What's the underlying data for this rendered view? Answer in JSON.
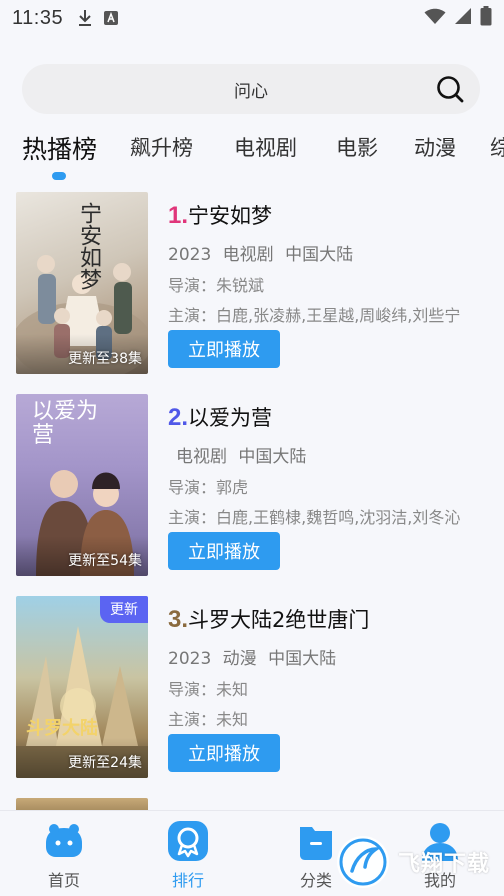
{
  "status_bar": {
    "time": "11:35",
    "icons": [
      "download-icon",
      "text-a-icon",
      "wifi-icon",
      "signal-icon",
      "battery-icon"
    ]
  },
  "search": {
    "query": "问心",
    "icon": "search-icon"
  },
  "tabs": [
    {
      "label": "热播榜",
      "active": true
    },
    {
      "label": "飙升榜",
      "active": false
    },
    {
      "label": "电视剧",
      "active": false
    },
    {
      "label": "电影",
      "active": false
    },
    {
      "label": "动漫",
      "active": false
    },
    {
      "label": "综",
      "active": false
    }
  ],
  "items": [
    {
      "rank": "1.",
      "rank_color": "#e0357a",
      "title": "宁安如梦",
      "year": "2023",
      "genre": "电视剧",
      "region": "中国大陆",
      "director_label": "导演：",
      "director": "朱锐斌",
      "cast_label": "主演：",
      "cast": "白鹿,张凌赫,王星越,周峻纬,刘些宁",
      "update": "更新至38集",
      "badge": "",
      "play_label": "立即播放",
      "poster_text": "宁安如梦"
    },
    {
      "rank": "2.",
      "rank_color": "#5058e8",
      "title": "以爱为营",
      "year": "",
      "genre": "电视剧",
      "region": "中国大陆",
      "director_label": "导演：",
      "director": "郭虎",
      "cast_label": "主演：",
      "cast": "白鹿,王鹤棣,魏哲鸣,沈羽洁,刘冬沁",
      "update": "更新至54集",
      "badge": "",
      "play_label": "立即播放",
      "poster_text": "以爱为营"
    },
    {
      "rank": "3.",
      "rank_color": "#8a6a3e",
      "title": "斗罗大陆2绝世唐门",
      "year": "2023",
      "genre": "动漫",
      "region": "中国大陆",
      "director_label": "导演：",
      "director": "未知",
      "cast_label": "主演：",
      "cast": "未知",
      "update": "更新至24集",
      "badge": "更新",
      "play_label": "立即播放",
      "poster_text": "斗罗大陆"
    }
  ],
  "bottom_nav": [
    {
      "label": "首页",
      "icon": "home-icon",
      "active": false
    },
    {
      "label": "排行",
      "icon": "ranking-icon",
      "active": true
    },
    {
      "label": "分类",
      "icon": "category-icon",
      "active": false
    },
    {
      "label": "我的",
      "icon": "profile-icon",
      "active": false
    }
  ],
  "watermark": {
    "text": "飞翔下载"
  },
  "colors": {
    "accent": "#2e9bf0",
    "background": "#f6f7fb"
  }
}
